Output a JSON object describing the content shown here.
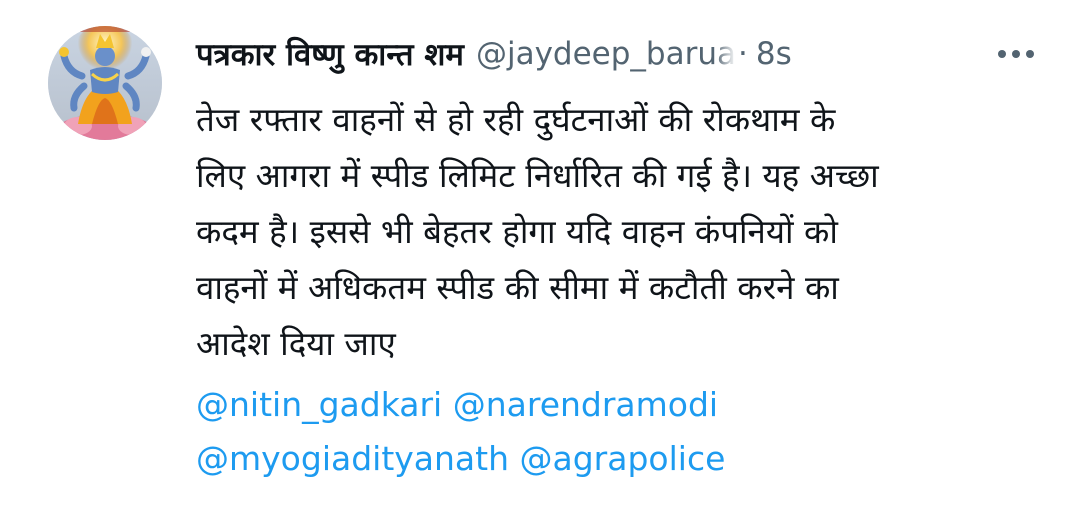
{
  "tweet": {
    "author": {
      "display_name": "पत्रकार विष्णु कान्त शम",
      "handle": "@jaydeep_barua",
      "avatar_icon": "deity-avatar-icon"
    },
    "separator": "·",
    "timestamp": "8s",
    "more_icon": "more-options-icon",
    "body_lines": [
      "तेज रफ्तार वाहनों से हो रही दुर्घटनाओं की रोकथाम के",
      "लिए आगरा में स्पीड लिमिट निर्धारित की गई है। यह अच्छा",
      "कदम है। इससे भी बेहतर होगा यदि वाहन कंपनियों को",
      "वाहनों में अधिकतम स्पीड की सीमा में कटौती करने का",
      "आदेश दिया जाए"
    ],
    "mentions": [
      [
        "@nitin_gadkari",
        "@narendramodi"
      ],
      [
        "@myogiadityanath",
        "@agrapolice"
      ]
    ]
  },
  "colors": {
    "text_primary": "#0f1419",
    "text_secondary": "#536471",
    "link": "#1d9bf0",
    "background": "#ffffff"
  }
}
